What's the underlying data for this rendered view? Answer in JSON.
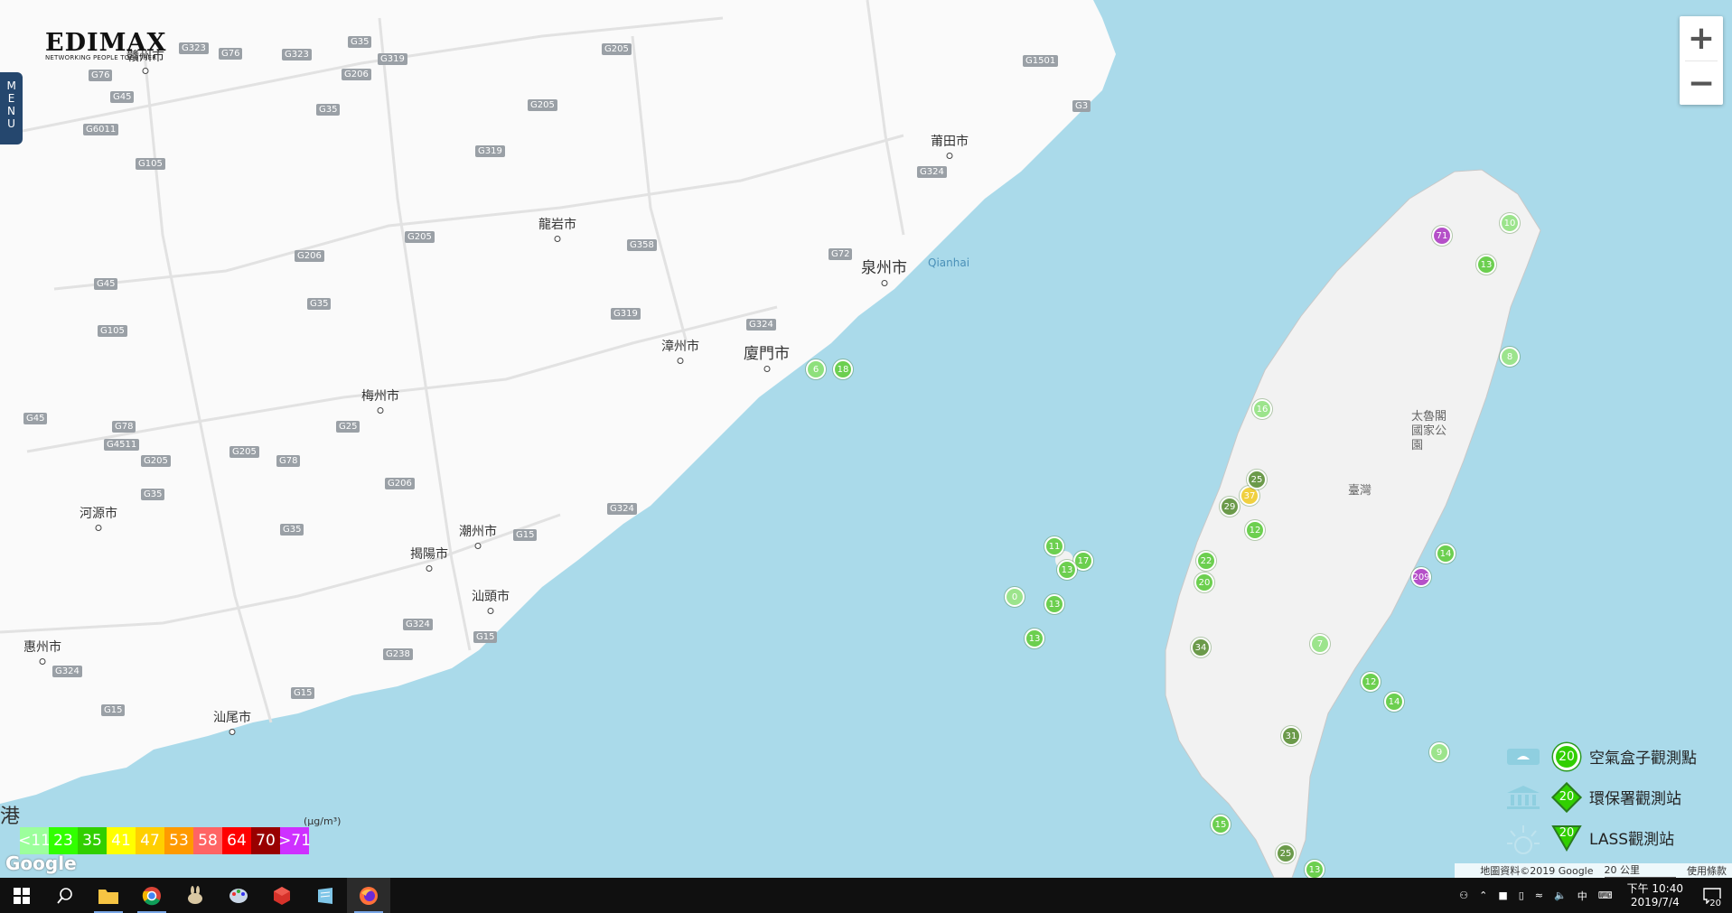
{
  "logo": {
    "text": "EDIMAX",
    "tagline": "NETWORKING PEOPLE TOGETHER"
  },
  "menu": {
    "label": "MENU"
  },
  "zoom": {
    "in_label": "+",
    "out_label": "−"
  },
  "map": {
    "cities": [
      {
        "name": "贛州市"
      },
      {
        "name": "龍岩市"
      },
      {
        "name": "莆田市"
      },
      {
        "name": "泉州市"
      },
      {
        "name": "漳州市"
      },
      {
        "name": "廈門市"
      },
      {
        "name": "梅州市"
      },
      {
        "name": "河源市"
      },
      {
        "name": "潮州市"
      },
      {
        "name": "揭陽市"
      },
      {
        "name": "汕頭市"
      },
      {
        "name": "惠州市"
      },
      {
        "name": "汕尾市"
      },
      {
        "name": "Qianhai"
      },
      {
        "name": "太魯閣國家公園"
      },
      {
        "name": "臺灣"
      },
      {
        "name": "港"
      }
    ],
    "highways": [
      "G323",
      "G76",
      "G323",
      "G35",
      "G319",
      "G205",
      "G76",
      "G206",
      "G45",
      "G35",
      "G6011",
      "G105",
      "G319",
      "G205",
      "G1501",
      "G3",
      "G324",
      "G205",
      "G358",
      "G72",
      "G206",
      "G45",
      "G35",
      "G319",
      "G324",
      "G105",
      "G45",
      "G78",
      "G4511",
      "G205",
      "G78",
      "G25",
      "G205",
      "G35",
      "G206",
      "G324",
      "G35",
      "G15",
      "G324",
      "G238",
      "G15",
      "G324",
      "G15",
      "G15"
    ],
    "markers": [
      {
        "value": "6"
      },
      {
        "value": "18"
      },
      {
        "value": "11"
      },
      {
        "value": "17"
      },
      {
        "value": "13"
      },
      {
        "value": "0"
      },
      {
        "value": "13"
      },
      {
        "value": "13"
      },
      {
        "value": "71"
      },
      {
        "value": "209"
      },
      {
        "value": "37"
      },
      {
        "value": "29"
      },
      {
        "value": "12"
      },
      {
        "value": "25"
      },
      {
        "value": "14"
      },
      {
        "value": "34"
      },
      {
        "value": "31"
      },
      {
        "value": "15"
      },
      {
        "value": "25"
      },
      {
        "value": "13"
      },
      {
        "value": "9"
      },
      {
        "value": "10"
      },
      {
        "value": "13"
      },
      {
        "value": "16"
      },
      {
        "value": "20"
      },
      {
        "value": "22"
      },
      {
        "value": "8"
      },
      {
        "value": "7"
      },
      {
        "value": "14"
      },
      {
        "value": "12"
      }
    ]
  },
  "pm_scale": {
    "unit": "(μg/m³)",
    "levels": [
      {
        "label": "<11",
        "color": "#9cff9c"
      },
      {
        "label": "23",
        "color": "#31ff00"
      },
      {
        "label": "35",
        "color": "#31cf00"
      },
      {
        "label": "41",
        "color": "#ffff00"
      },
      {
        "label": "47",
        "color": "#ffcf00"
      },
      {
        "label": "53",
        "color": "#ff9a00"
      },
      {
        "label": "58",
        "color": "#ff6464"
      },
      {
        "label": "64",
        "color": "#ff0000"
      },
      {
        "label": "70",
        "color": "#990000"
      },
      {
        "label": ">71",
        "color": "#ce30ff"
      }
    ]
  },
  "google_logo": "Google",
  "legend": [
    {
      "label": "空氣盒子觀測點",
      "value": "20",
      "icon": "airbox-icon"
    },
    {
      "label": "環保署觀測站",
      "value": "20",
      "icon": "government-building-icon"
    },
    {
      "label": "LASS觀測站",
      "value": "20",
      "icon": "sun-icon"
    }
  ],
  "attribution": {
    "data": "地圖資料©2019 Google",
    "scale": "20 公里",
    "terms": "使用條款"
  },
  "taskbar": {
    "ime": "中",
    "time": "下午 10:40",
    "date": "2019/7/4",
    "notifications": "20"
  }
}
